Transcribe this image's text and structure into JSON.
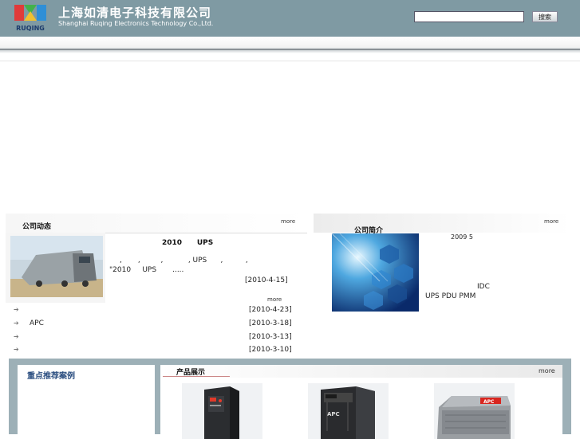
{
  "header": {
    "company_name_cn": "上海如清电子科技有限公司",
    "company_name_en": "Shanghai Ruqing Electronics Technology Co.,Ltd.",
    "logo_text": "RUQING",
    "search_placeholder": "",
    "search_button_label": "搜索"
  },
  "news": {
    "title": "公司动态",
    "more_label": "more",
    "feature_headline": "2010      UPS",
    "feature_summary_line1": ",       ,         ,           , UPS      ,          ,",
    "feature_summary_line2": "\"2010     UPS       .....",
    "feature_date": "[2010-4-15]",
    "list_more_label": "more",
    "items": [
      {
        "text": "",
        "date": "[2010-4-23]"
      },
      {
        "text": "APC",
        "date": "[2010-3-18]"
      },
      {
        "text": "",
        "date": "[2010-3-13]"
      },
      {
        "text": "",
        "date": "[2010-3-10]"
      }
    ]
  },
  "about": {
    "title": "公司简介",
    "more_label": "more",
    "line1": "2009 5",
    "line2": "IDC",
    "line3": "UPS PDU PMM"
  },
  "cases": {
    "title": "重点推荐案例"
  },
  "products": {
    "title": "产品展示",
    "more_label": "more",
    "items": [
      {
        "label": "UPS tower unit"
      },
      {
        "label": "APC"
      },
      {
        "label": "APC"
      }
    ]
  },
  "colors": {
    "header_bg": "#7f9aa3",
    "bottom_bg": "#9db0b7",
    "cases_title": "#2b4e80"
  }
}
